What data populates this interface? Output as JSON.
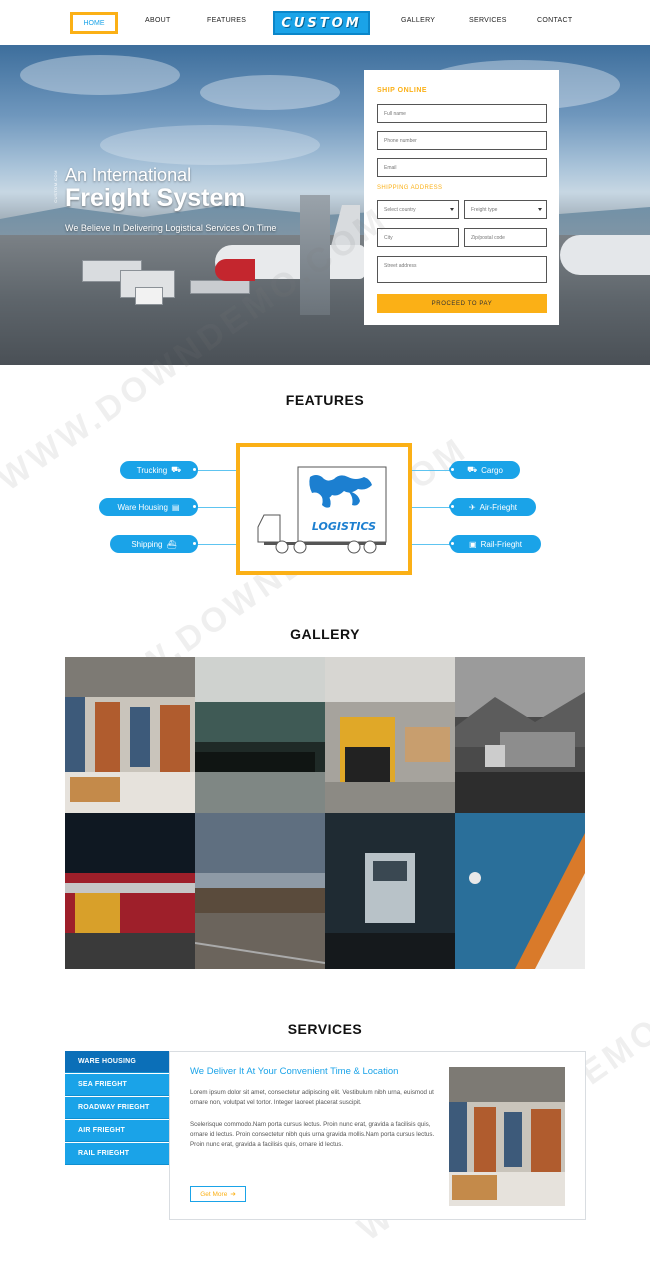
{
  "nav": {
    "home": "HOME",
    "about": "ABOUT",
    "features": "FEATURES",
    "logo": "CUSTOM",
    "gallery": "GALLERY",
    "services": "SERVICES",
    "contact": "CONTACT"
  },
  "hero": {
    "side_text": "CUSTOM.COM",
    "line1": "An International",
    "line2": "Freight System",
    "tagline": "We Believe In Delivering Logistical Services On Time"
  },
  "form": {
    "heading": "SHIP ONLINE",
    "full_name": "Full name",
    "phone": "Phone number",
    "email": "Email",
    "sub_heading": "SHIPPING ADDRESS",
    "country": "Select country",
    "freight_type": "Freight type",
    "city": "City",
    "zip": "Zip/postal code",
    "street": "Street address",
    "proceed": "PROCEED TO PAY"
  },
  "features": {
    "title": "FEATURES",
    "left": [
      {
        "label": "Trucking",
        "icon": "truck-icon",
        "glyph": "⛟"
      },
      {
        "label": "Ware Housing",
        "icon": "warehouse-icon",
        "glyph": "▤"
      },
      {
        "label": "Shipping",
        "icon": "ship-icon",
        "glyph": "⛴"
      }
    ],
    "right": [
      {
        "label": "Cargo",
        "icon": "cargo-icon",
        "glyph": "⛟"
      },
      {
        "label": "Air-Frieght",
        "icon": "plane-icon",
        "glyph": "✈"
      },
      {
        "label": "Rail-Frieght",
        "icon": "train-icon",
        "glyph": "▣"
      }
    ],
    "center_logo_text": "LOGISTICS"
  },
  "gallery": {
    "title": "GALLERY"
  },
  "services": {
    "title": "SERVICES",
    "tabs": [
      "WARE HOUSING",
      "SEA FRIEGHT",
      "ROADWAY FRIEGHT",
      "AIR FRIEGHT",
      "RAIL FRIEGHT"
    ],
    "heading": "We Deliver It At Your Convenient Time & Location",
    "para1": "Lorem ipsum dolor sit amet, consectetur adipiscing elit. Vestibulum nibh urna, euismod ut ornare non, volutpat vel tortor. Integer laoreet placerat suscipit.",
    "para2": "Scelerisque commodo.Nam porta cursus lectus. Proin nunc erat, gravida a facilisis quis, ornare id lectus. Proin consectetur nibh quis urna gravida mollis.Nam porta cursus lectus. Proin nunc erat, gravida a facilisis quis, ornare id lectus.",
    "get_more": "Get More"
  },
  "watermark": "WWW.DOWNDEMO.COM",
  "colors": {
    "accent_blue": "#1aa3e8",
    "accent_yellow": "#fbb016",
    "tab_active": "#0b6fb8"
  }
}
